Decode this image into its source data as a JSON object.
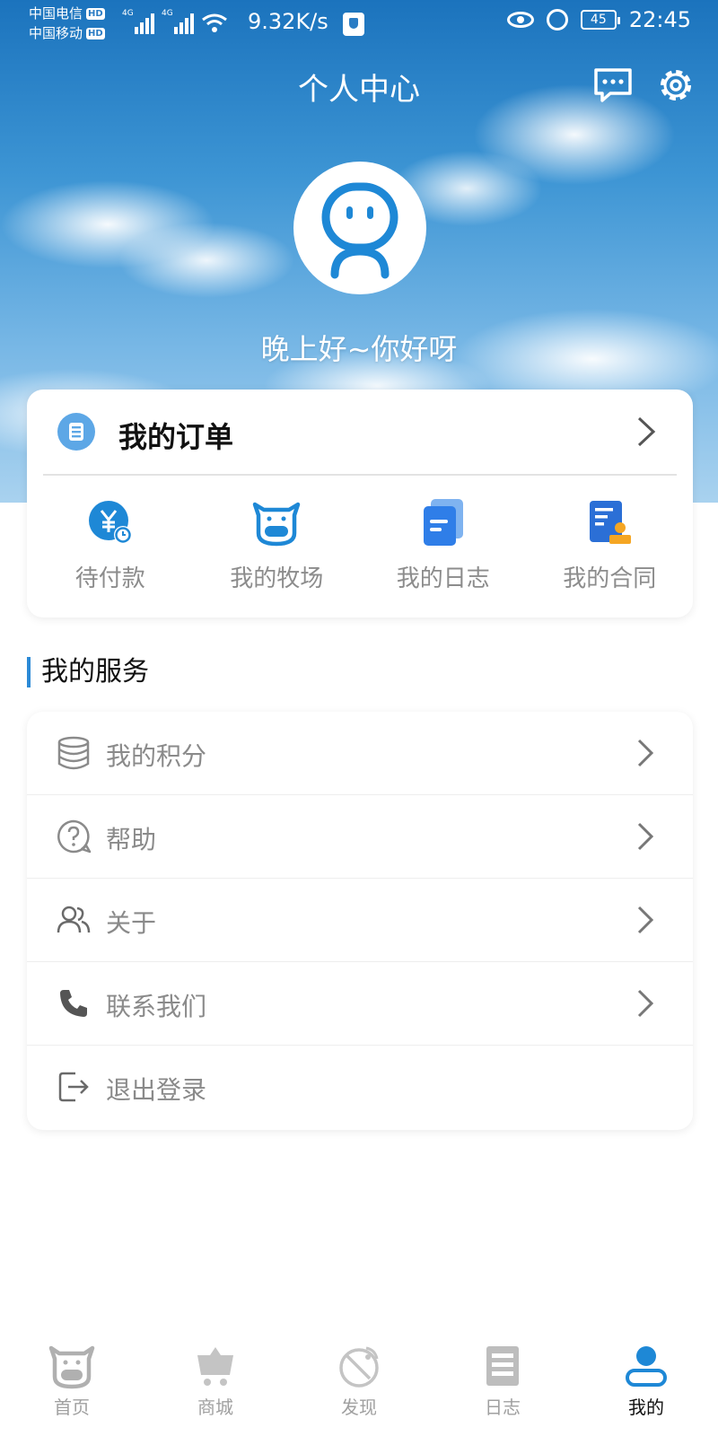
{
  "status_bar": {
    "carrier_1": "中国电信",
    "carrier_2": "中国移动",
    "hd_badge": "HD",
    "network_1": "4G",
    "network_2": "4G",
    "net_speed": "9.32K/s",
    "battery": "45",
    "time": "22:45"
  },
  "header": {
    "title": "个人中心",
    "greeting": "晚上好~你好呀"
  },
  "orders": {
    "title": "我的订单",
    "items": [
      {
        "label": "待付款",
        "icon": "yen-clock-icon"
      },
      {
        "label": "我的牧场",
        "icon": "cow-icon"
      },
      {
        "label": "我的日志",
        "icon": "log-doc-icon"
      },
      {
        "label": "我的合同",
        "icon": "contract-stamp-icon"
      }
    ]
  },
  "services": {
    "title": "我的服务",
    "items": [
      {
        "label": "我的积分",
        "icon": "database-icon",
        "has_chevron": true
      },
      {
        "label": "帮助",
        "icon": "help-icon",
        "has_chevron": true
      },
      {
        "label": "关于",
        "icon": "users-icon",
        "has_chevron": true
      },
      {
        "label": "联系我们",
        "icon": "phone-icon",
        "has_chevron": true
      },
      {
        "label": "退出登录",
        "icon": "logout-icon",
        "has_chevron": false
      }
    ]
  },
  "tabbar": {
    "items": [
      {
        "label": "首页",
        "icon": "cow-home-icon",
        "active": false
      },
      {
        "label": "商城",
        "icon": "cart-icon",
        "active": false
      },
      {
        "label": "发现",
        "icon": "satellite-icon",
        "active": false
      },
      {
        "label": "日志",
        "icon": "journal-icon",
        "active": false
      },
      {
        "label": "我的",
        "icon": "profile-icon",
        "active": true
      }
    ]
  },
  "colors": {
    "accent": "#2b8ad6",
    "icon_blue": "#1e88d6",
    "label_gray": "#8a8a8a",
    "contract_orange": "#f5a623"
  }
}
